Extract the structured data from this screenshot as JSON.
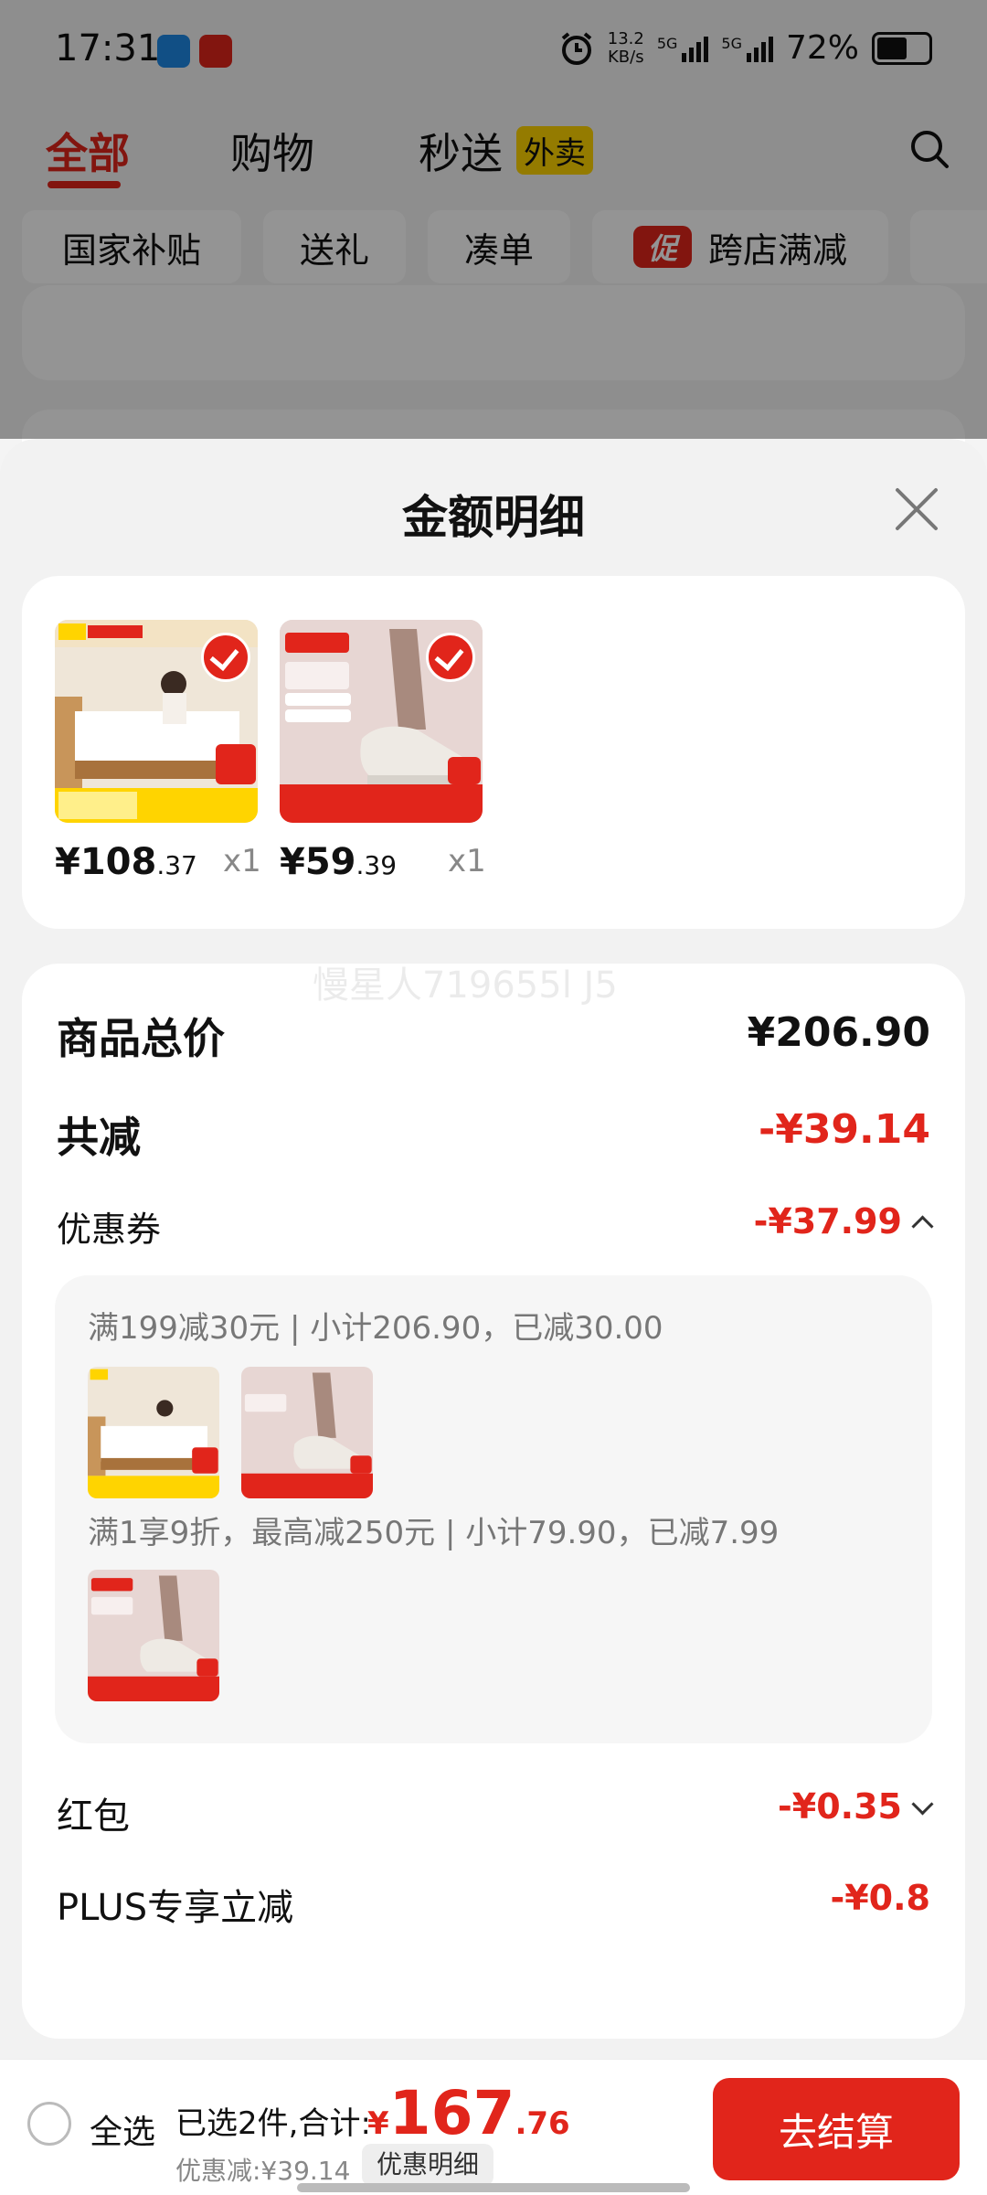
{
  "status_bar": {
    "time": "17:31",
    "net_speed_value": "13.2",
    "net_speed_unit": "KB/s",
    "network_1": "5G",
    "network_2": "5G",
    "battery": "72%"
  },
  "top_nav": {
    "tabs": [
      {
        "label": "全部",
        "active": true
      },
      {
        "label": "购物",
        "active": false
      },
      {
        "label": "秒送",
        "active": false
      }
    ],
    "takeout_badge": "外卖"
  },
  "filter_chips": [
    "国家补贴",
    "送礼",
    "凑单",
    "跨店满减"
  ],
  "promo_tag": "促",
  "sheet": {
    "title": "金额明细",
    "items": [
      {
        "price_int": "¥108",
        "price_dec": ".37",
        "qty": "x1",
        "product": "mattress"
      },
      {
        "price_int": "¥59",
        "price_dec": ".39",
        "qty": "x1",
        "product": "shoes"
      }
    ],
    "watermark": "慢星人719655l J5",
    "summary": {
      "total_label": "商品总价",
      "total_value": "¥206.90",
      "discount_label": "共减",
      "discount_value": "-¥39.14",
      "coupon_label": "优惠券",
      "coupon_value": "-¥37.99",
      "coupon_lines": [
        "满199减30元 | 小计206.90，已减30.00",
        "满1享9折，最高减250元 | 小计79.90，已减7.99"
      ],
      "redpacket_label": "红包",
      "redpacket_value": "-¥0.35",
      "plus_label": "PLUS专享立减",
      "plus_value": "-¥0.8"
    }
  },
  "bottom_bar": {
    "select_all": "全选",
    "selected": "已选2件,合计:",
    "currency": "¥",
    "total_int": "167",
    "total_dec": ".76",
    "discount": "优惠减:¥39.14",
    "detail_button": "优惠明细",
    "checkout": "去结算"
  },
  "colors": {
    "accent": "#e1251b",
    "takeout_badge": "#ffd400"
  }
}
